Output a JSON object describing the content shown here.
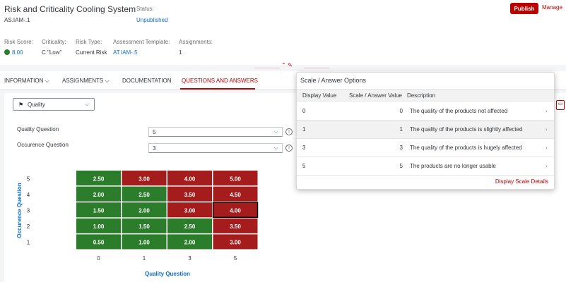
{
  "header": {
    "title": "Risk and Criticality Cooling System",
    "subtitle": "AS.IAM-.1",
    "status_label": "Status:",
    "status_value": "Unpublished",
    "publish_label": "Publish",
    "manage_label": "Manage"
  },
  "attributes": {
    "risk_score_label": "Risk Score:",
    "risk_score_value": "8.00",
    "criticality_label": "Criticality:",
    "criticality_value": "C \"Low\"",
    "risk_type_label": "Risk Type:",
    "risk_type_value": "Current Risk",
    "template_label": "Assessment Template:",
    "template_value": "AT.IAM-.5",
    "assignments_label": "Assignments:",
    "assignments_value": "1",
    "score_color": "#2b7d2b"
  },
  "tabs": [
    {
      "label": "INFORMATION",
      "active": false
    },
    {
      "label": "ASSIGNMENTS",
      "active": false
    },
    {
      "label": "DOCUMENTATION",
      "active": false
    },
    {
      "label": "QUESTIONS AND ANSWERS",
      "active": true
    }
  ],
  "filter": {
    "value": "Quality",
    "icon": "quality-icon"
  },
  "questions": [
    {
      "label": "Quality Question",
      "value": "5"
    },
    {
      "label": "Occurence Question",
      "value": "3"
    }
  ],
  "chart_data": {
    "type": "heatmap",
    "xlabel": "Quality Question",
    "ylabel": "Occurence Question",
    "x": [
      "0",
      "1",
      "3",
      "5"
    ],
    "y": [
      "5",
      "4",
      "3",
      "2",
      "1"
    ],
    "values": [
      [
        "2.50",
        "3.00",
        "4.00",
        "5.00"
      ],
      [
        "2.00",
        "2.50",
        "3.50",
        "4.50"
      ],
      [
        "1.50",
        "2.00",
        "3.00",
        "4.00"
      ],
      [
        "1.00",
        "1.50",
        "2.50",
        "3.50"
      ],
      [
        "0.50",
        "1.00",
        "2.00",
        "3.00"
      ]
    ],
    "colors": [
      [
        "green",
        "red",
        "red",
        "red"
      ],
      [
        "green",
        "green",
        "red",
        "red"
      ],
      [
        "green",
        "green",
        "red",
        "red"
      ],
      [
        "green",
        "green",
        "green",
        "red"
      ],
      [
        "green",
        "green",
        "green",
        "red"
      ]
    ],
    "highlight": {
      "row": 2,
      "col": 3
    },
    "green": "#2b7d2b",
    "red": "#a51c1c"
  },
  "popover": {
    "title": "Scale / Answer Options",
    "headers": [
      "Display Value",
      "Scale / Answer Value",
      "Description"
    ],
    "rows": [
      {
        "display": "0",
        "scale": "0",
        "desc": "The quality of the products not affected",
        "highlight": false
      },
      {
        "display": "1",
        "scale": "1",
        "desc": "The quality of the products is slightly affected",
        "highlight": true
      },
      {
        "display": "3",
        "scale": "3",
        "desc": "The quality of the products is hugely affected",
        "highlight": false
      },
      {
        "display": "5",
        "scale": "5",
        "desc": "The products are no longer usable",
        "highlight": false
      }
    ],
    "link_label": "Display Scale Details"
  }
}
